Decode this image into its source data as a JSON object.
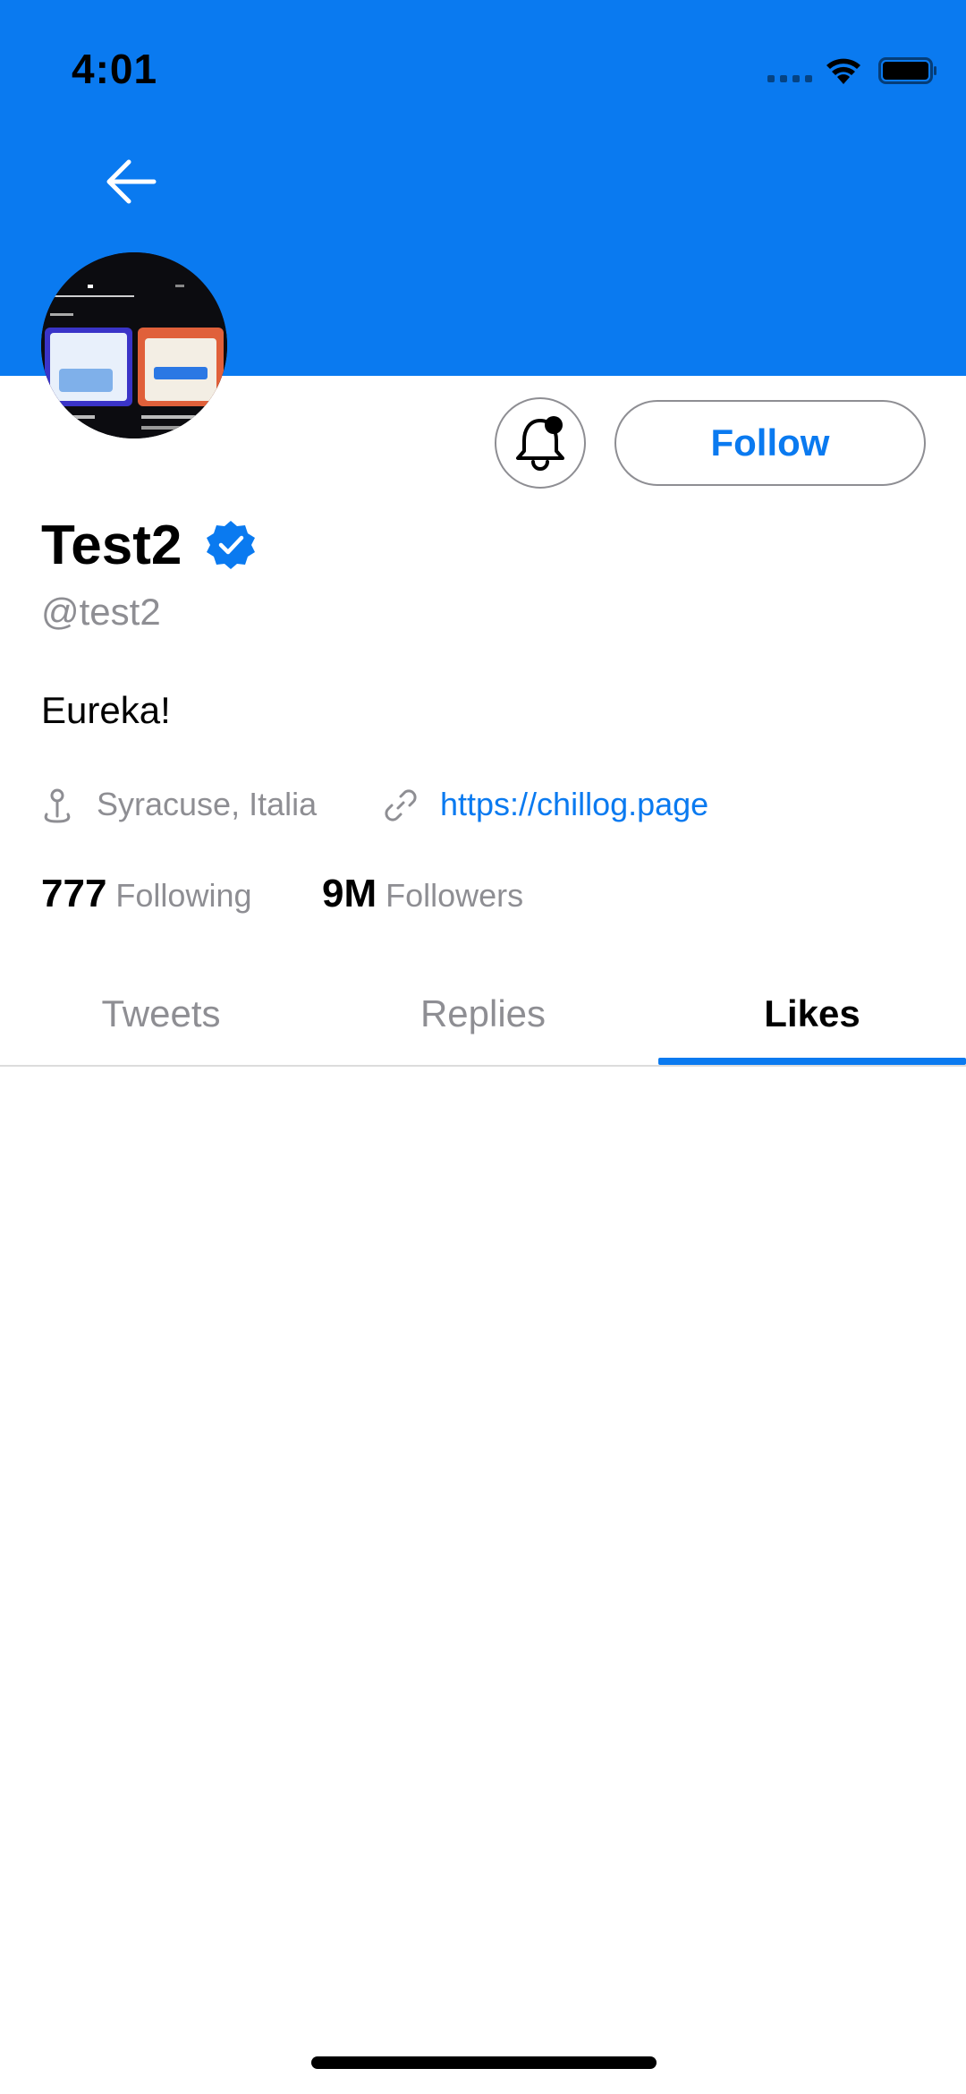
{
  "status_bar": {
    "time": "4:01"
  },
  "profile": {
    "display_name": "Test2",
    "handle": "@test2",
    "bio": "Eureka!",
    "location": "Syracuse, Italia",
    "website": "https://chillog.page",
    "verified": true
  },
  "actions": {
    "follow_label": "Follow"
  },
  "stats": {
    "following_count": "777",
    "following_label": "Following",
    "followers_count": "9M",
    "followers_label": "Followers"
  },
  "tabs": [
    {
      "label": "Tweets",
      "active": false
    },
    {
      "label": "Replies",
      "active": false
    },
    {
      "label": "Likes",
      "active": true
    }
  ],
  "colors": {
    "accent": "#0a7af0",
    "secondary_text": "#8e8e93",
    "primary_text": "#000000"
  },
  "icons": {
    "back": "arrow-left-icon",
    "bell": "bell-icon",
    "verified": "verified-badge-icon",
    "location": "location-pin-icon",
    "link": "link-icon"
  }
}
